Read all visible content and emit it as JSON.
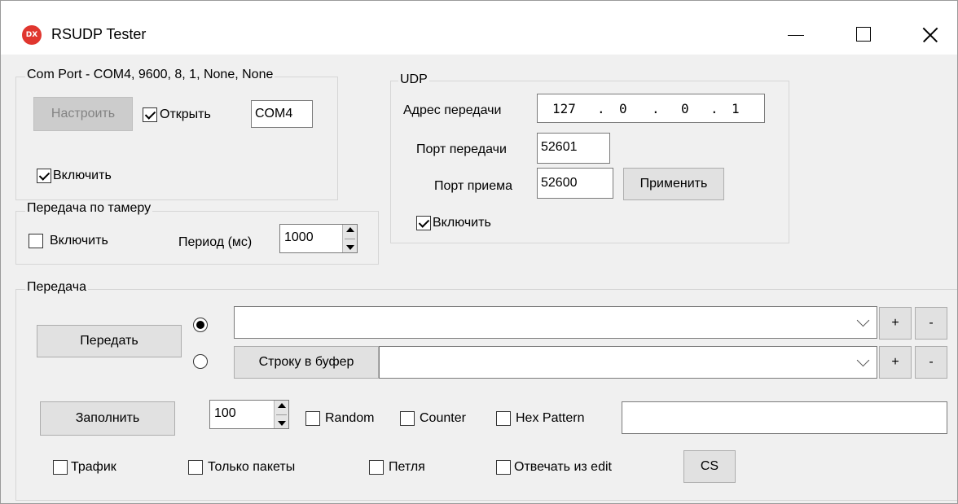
{
  "window": {
    "title": "RSUDP Tester",
    "app_icon_text": "DX",
    "accent": "#e0362f"
  },
  "com_port": {
    "legend": "Com Port - COM4, 9600, 8, 1, None, None",
    "setup_label": "Настроить",
    "open_label": "Открыть",
    "open_checked": true,
    "port_value": "COM4",
    "enable_label": "Включить",
    "enable_checked": true
  },
  "timer": {
    "legend": "Передача по тамеру",
    "enable_label": "Включить",
    "enable_checked": false,
    "period_label": "Период (мс)",
    "period_value": "1000"
  },
  "udp": {
    "legend": "UDP",
    "addr_label": "Адрес передачи",
    "addr_octets": [
      "127",
      "0",
      "0",
      "1"
    ],
    "tx_port_label": "Порт передачи",
    "tx_port_value": "52601",
    "rx_port_label": "Порт приема",
    "rx_port_value": "52600",
    "apply_label": "Применить",
    "enable_label": "Включить",
    "enable_checked": true
  },
  "transfer": {
    "legend": "Передача",
    "send_label": "Передать",
    "to_buffer_label": "Строку в буфер",
    "combo1_value": "",
    "combo2_value": "",
    "plus_label": "+",
    "minus_label": "-",
    "fill_label": "Заполнить",
    "fill_count": "100",
    "random_label": "Random",
    "counter_label": "Counter",
    "hex_pattern_label": "Hex Pattern",
    "hex_pattern_value": "",
    "traffic_label": "Трафик",
    "packets_only_label": "Только пакеты",
    "loop_label": "Петля",
    "reply_edit_label": "Отвечать из edit",
    "cs_label": "CS"
  }
}
